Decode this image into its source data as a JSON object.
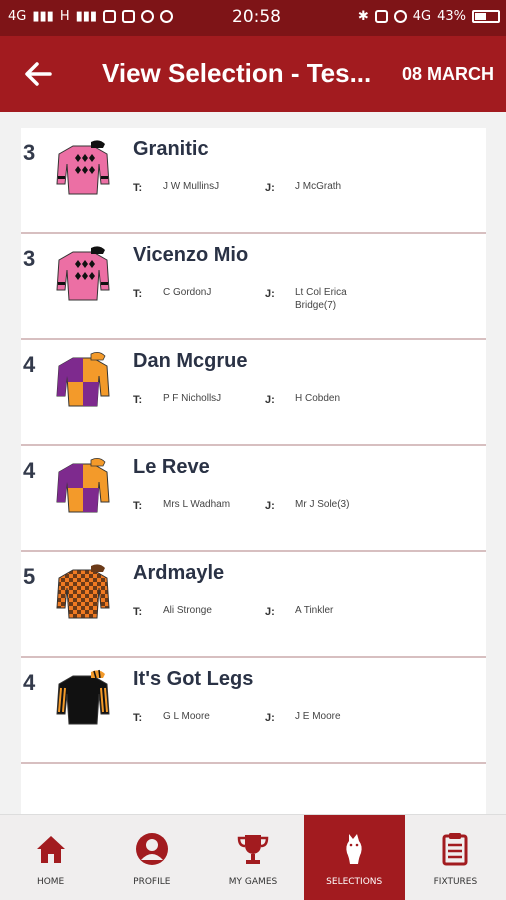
{
  "status_bar": {
    "network_left": "4G",
    "network_mid": "H",
    "time": "20:58",
    "network_right": "4G",
    "battery": "43%"
  },
  "app_bar": {
    "title": "View Selection - Tes...",
    "date": "08 MARCH"
  },
  "labels": {
    "trainer": "T:",
    "jockey": "J:"
  },
  "selections": [
    {
      "number": "3",
      "horse": "Granitic",
      "trainer": "J W MullinsJ",
      "jockey": "J McGrath",
      "silks": "pink-diamonds"
    },
    {
      "number": "3",
      "horse": "Vicenzo Mio",
      "trainer": "C GordonJ",
      "jockey": "Lt Col Erica Bridge(7)",
      "silks": "pink-diamonds"
    },
    {
      "number": "4",
      "horse": "Dan Mcgrue",
      "trainer": "P F NichollsJ",
      "jockey": "H Cobden",
      "silks": "orange-purple"
    },
    {
      "number": "4",
      "horse": "Le Reve",
      "trainer": "Mrs L Wadham",
      "jockey": "Mr J Sole(3)",
      "silks": "orange-purple"
    },
    {
      "number": "5",
      "horse": "Ardmayle",
      "trainer": "Ali Stronge",
      "jockey": "A Tinkler",
      "silks": "orange-check"
    },
    {
      "number": "4",
      "horse": "It's Got Legs",
      "trainer": "G L Moore",
      "jockey": "J E Moore",
      "silks": "black-orange"
    }
  ],
  "bottom_nav": [
    {
      "label": "HOME",
      "icon": "home-icon"
    },
    {
      "label": "PROFILE",
      "icon": "profile-icon"
    },
    {
      "label": "MY GAMES",
      "icon": "trophy-icon"
    },
    {
      "label": "SELECTIONS",
      "icon": "horse-icon",
      "active": true
    },
    {
      "label": "FIXTURES",
      "icon": "clipboard-icon"
    }
  ],
  "colors": {
    "status_bar": "#7e1417",
    "app_bar": "#a21b1f",
    "nav_active": "#a21b1f"
  }
}
